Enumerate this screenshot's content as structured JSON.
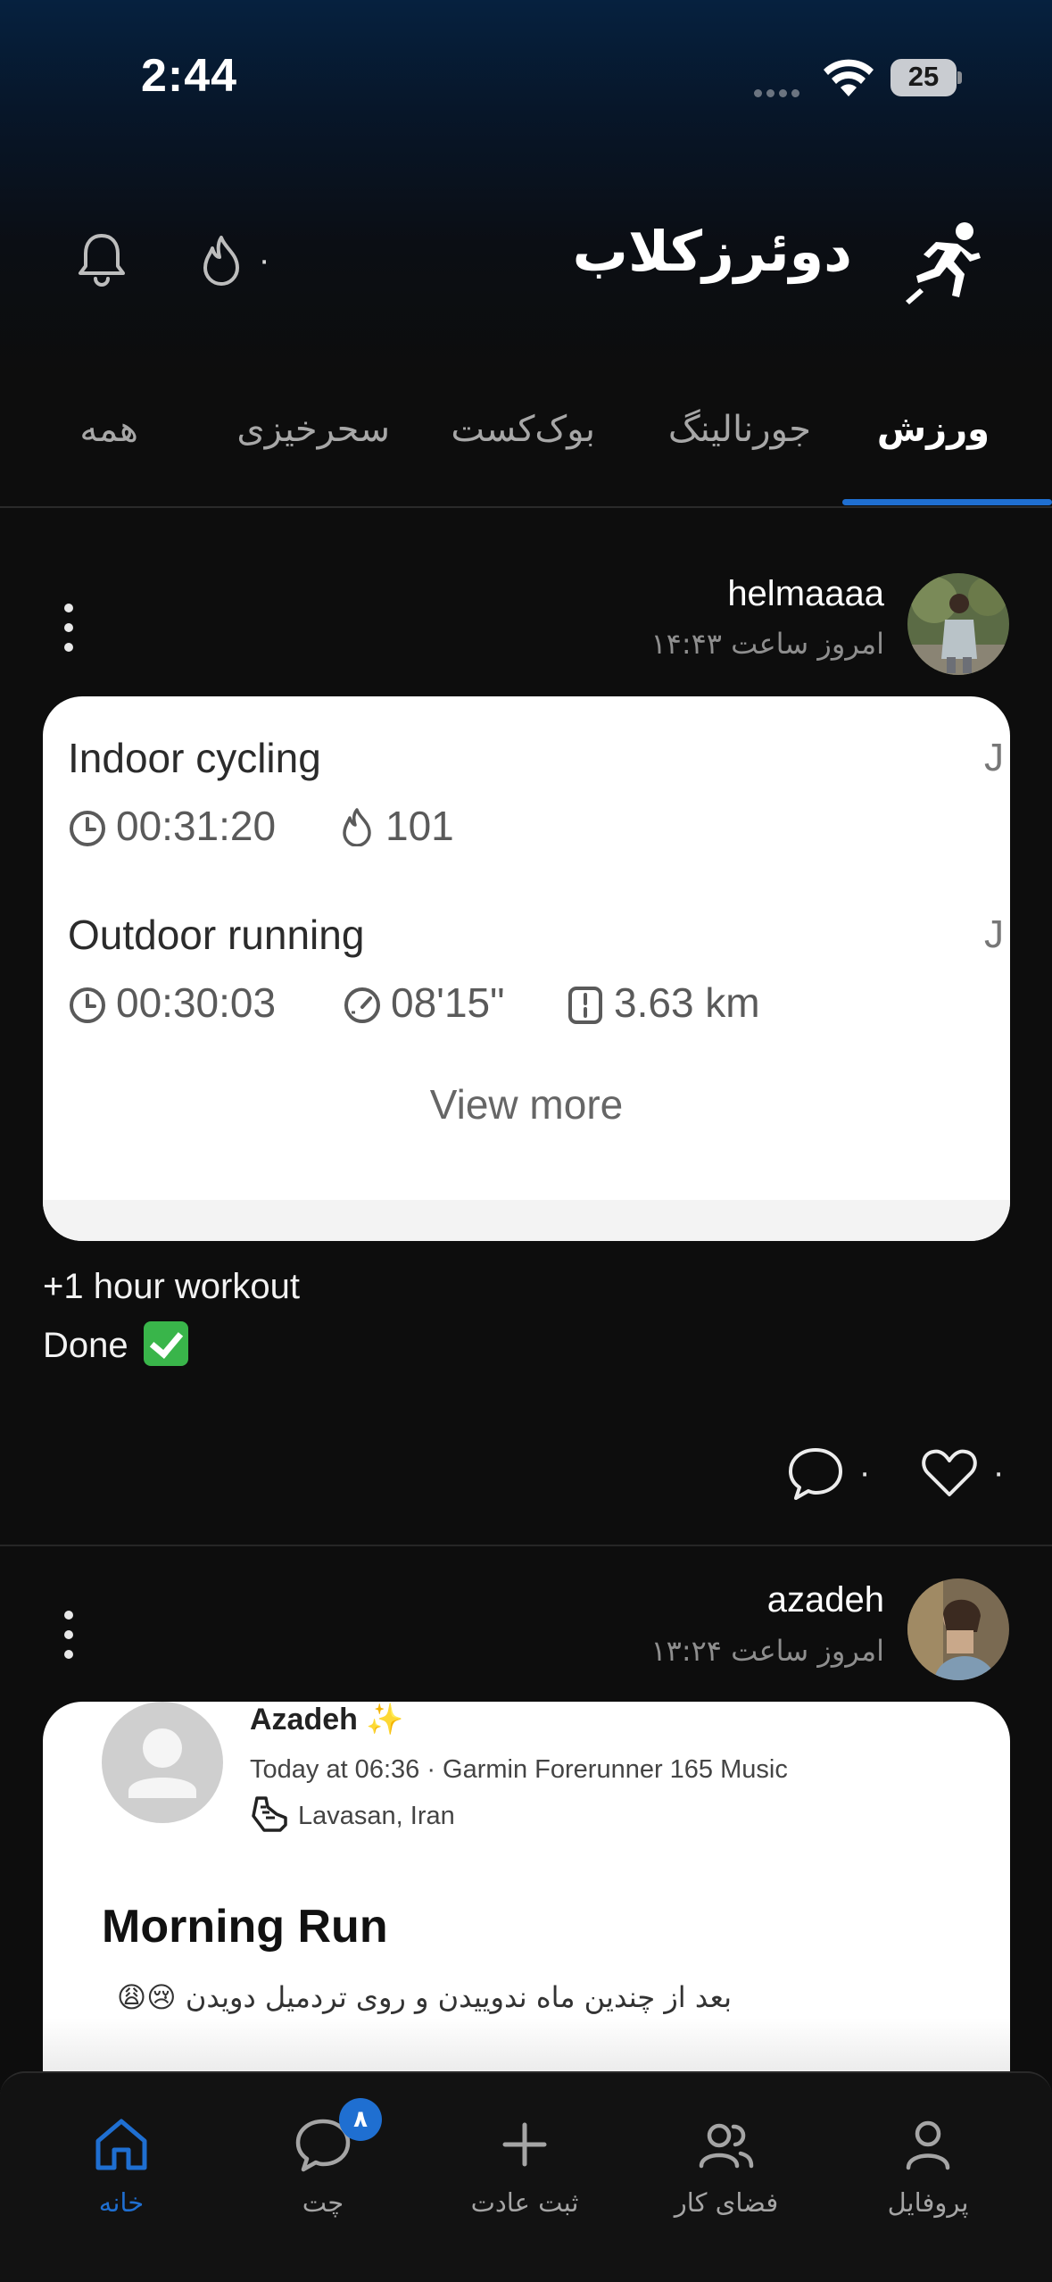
{
  "status_bar": {
    "time": "2:44",
    "battery": "25"
  },
  "header": {
    "app_title": "دوئرزکلاب",
    "streak_count": "۰"
  },
  "tabs": [
    {
      "label": "ورزش",
      "active": true
    },
    {
      "label": "جورنالینگ",
      "active": false
    },
    {
      "label": "بوک‌کست",
      "active": false
    },
    {
      "label": "سحرخیزی",
      "active": false
    },
    {
      "label": "همه",
      "active": false
    }
  ],
  "posts": [
    {
      "username": "helmaaaa",
      "time": "امروز ساعت ۱۴:۴۳",
      "activities": [
        {
          "title": "Indoor cycling",
          "duration": "00:31:20",
          "calories": "101",
          "trail": "J"
        },
        {
          "title": "Outdoor running",
          "duration": "00:30:03",
          "pace": "08'15\"",
          "distance": "3.63 km",
          "trail": "J"
        }
      ],
      "view_more": "View more",
      "caption_line1": "+1 hour workout",
      "caption_line2": "Done",
      "comments": "۰",
      "likes": "۰"
    },
    {
      "username": "azadeh",
      "time": "امروز ساعت ۱۳:۲۴",
      "strava": {
        "name": "Azadeh ✨",
        "meta": "Today at 06:36 · Garmin Forerunner 165 Music",
        "location": "Lavasan, Iran",
        "title": "Morning Run",
        "description": "بعد از چندین ماه ندوییدن و روی تردمیل دویدن 😢😩"
      }
    }
  ],
  "bottom_nav": [
    {
      "label": "پروفایل",
      "icon": "profile-icon",
      "active": false
    },
    {
      "label": "فضای کار",
      "icon": "workspace-icon",
      "active": false
    },
    {
      "label": "ثبت عادت",
      "icon": "plus-icon",
      "active": false
    },
    {
      "label": "چت",
      "icon": "chat-icon",
      "active": false,
      "badge": "۸"
    },
    {
      "label": "خانه",
      "icon": "home-icon",
      "active": true
    }
  ],
  "colors": {
    "accent": "#1f6fd1",
    "background": "#0d0d0d",
    "card": "#ffffff"
  }
}
